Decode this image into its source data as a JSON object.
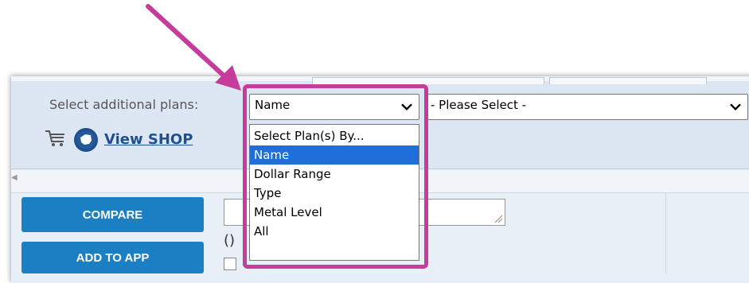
{
  "header": {
    "select_label": "Select additional plans:",
    "view_shop_link": "View SHOP"
  },
  "select_by": {
    "value": "Name",
    "options": [
      "Select Plan(s) By...",
      "Name",
      "Dollar Range",
      "Type",
      "Metal Level",
      "All"
    ],
    "selected_index": 1
  },
  "plan_select": {
    "value": "- Please Select -"
  },
  "buttons": {
    "compare": "COMPARE",
    "add_to_app": "ADD TO APP"
  },
  "content": {
    "paren_text": "()"
  },
  "colors": {
    "highlight": "#c63c9d",
    "button_blue": "#1b7fc3",
    "selected_option": "#1e6fd9",
    "link": "#1f4f8e"
  },
  "icons": [
    "cart-icon",
    "state-seal-icon",
    "chevron-down-icon",
    "resize-handle-icon",
    "annotation-arrow-icon"
  ]
}
